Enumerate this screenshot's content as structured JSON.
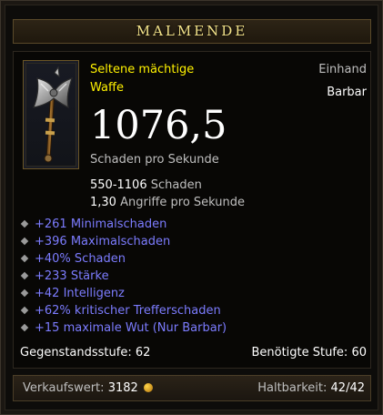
{
  "item": {
    "name": "MALMENDE",
    "rarity_line1": "Seltene mächtige",
    "rarity_line2": "Waffe",
    "slot": "Einhand",
    "class": "Barbar",
    "dps": "1076,5",
    "dps_label": "Schaden pro Sekunde",
    "damage_value": "550-1106",
    "damage_label": "Schaden",
    "aps_value": "1,30",
    "aps_label": "Angriffe pro Sekunde",
    "affixes": [
      "+261 Minimalschaden",
      "+396 Maximalschaden",
      "+40% Schaden",
      "+233 Stärke",
      "+42 Intelligenz",
      "+62% kritischer Trefferschaden",
      "+15 maximale Wut (Nur Barbar)"
    ],
    "item_level_label": "Gegenstandsstufe:",
    "item_level_value": "62",
    "required_level_label": "Benötigte Stufe:",
    "required_level_value": "60",
    "sell_label": "Verkaufswert:",
    "sell_value": "3182",
    "durability_label": "Haltbarkeit:",
    "durability_value": "42/42",
    "icon": "axe-icon",
    "colors": {
      "title": "#f3e38a",
      "rarity": "#fff200",
      "affix": "#7c7cff"
    }
  }
}
